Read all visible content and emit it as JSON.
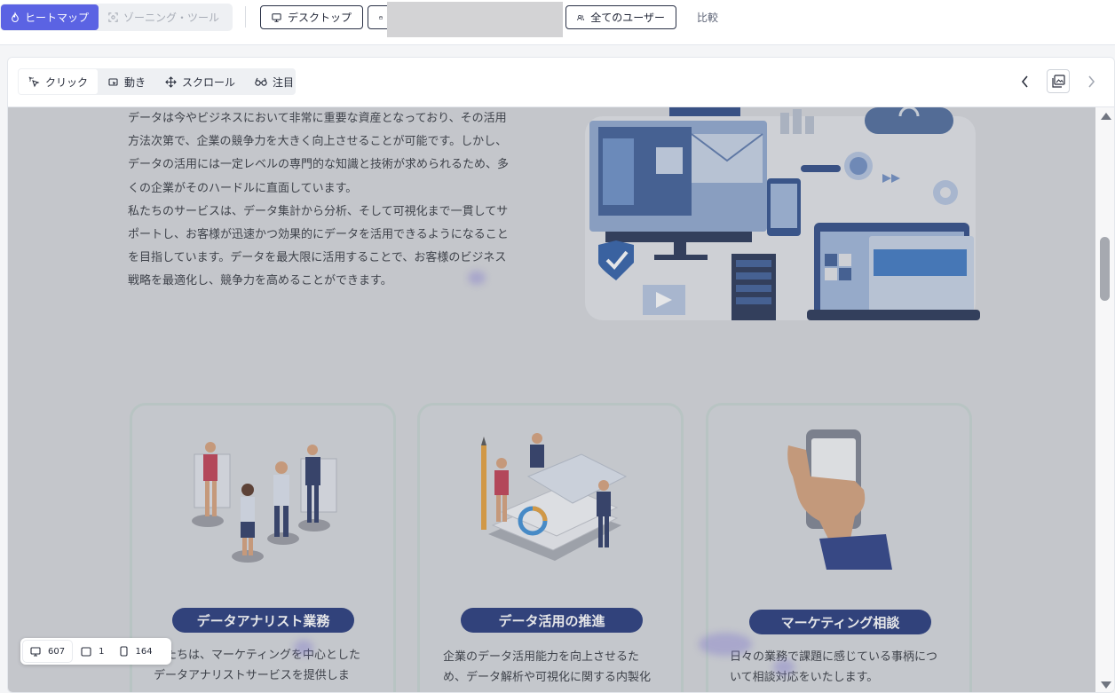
{
  "topbar": {
    "heatmap_label": "ヒートマップ",
    "zoning_label": "ゾーニング・ツール",
    "desktop_label": "デスクトップ",
    "users_label": "全てのユーザー",
    "compare_label": "比較"
  },
  "toolbar": {
    "tabs": [
      "クリック",
      "動き",
      "スクロール",
      "注目"
    ]
  },
  "page": {
    "intro_lines": [
      "データは今やビジネスにおいて非常に重要な資産となっており、その活用",
      "方法次第で、企業の競争力を大きく向上させることが可能です。しかし、",
      "データの活用には一定レベルの専門的な知識と技術が求められるため、多",
      "くの企業がそのハードルに直面しています。",
      "私たちのサービスは、データ集計から分析、そして可視化まで一貫してサ",
      "ポートし、お客様が迅速かつ効果的にデータを活用できるようになること",
      "を目指しています。データを最大限に活用することで、お客様のビジネス",
      "戦略を最適化し、競争力を高めることができます。"
    ],
    "cards": [
      {
        "title": "データアナリスト業務",
        "text_lines": [
          "私たちは、マーケティングを中心とした",
          "データアナリストサービスを提供しま"
        ]
      },
      {
        "title": "データ活用の推進",
        "text_lines": [
          "企業のデータ活用能力を向上させるた",
          "め、データ解析や可視化に関する内製化"
        ]
      },
      {
        "title": "マーケティング相談",
        "text_lines": [
          "日々の業務で課題に感じている事柄につ",
          "いて相談対応をいたします。"
        ]
      }
    ]
  },
  "devices": {
    "desktop_count": "607",
    "tablet_count": "1",
    "mobile_count": "164"
  },
  "colors": {
    "accent": "#5b63e3",
    "card_title_bg": "#24387a"
  }
}
